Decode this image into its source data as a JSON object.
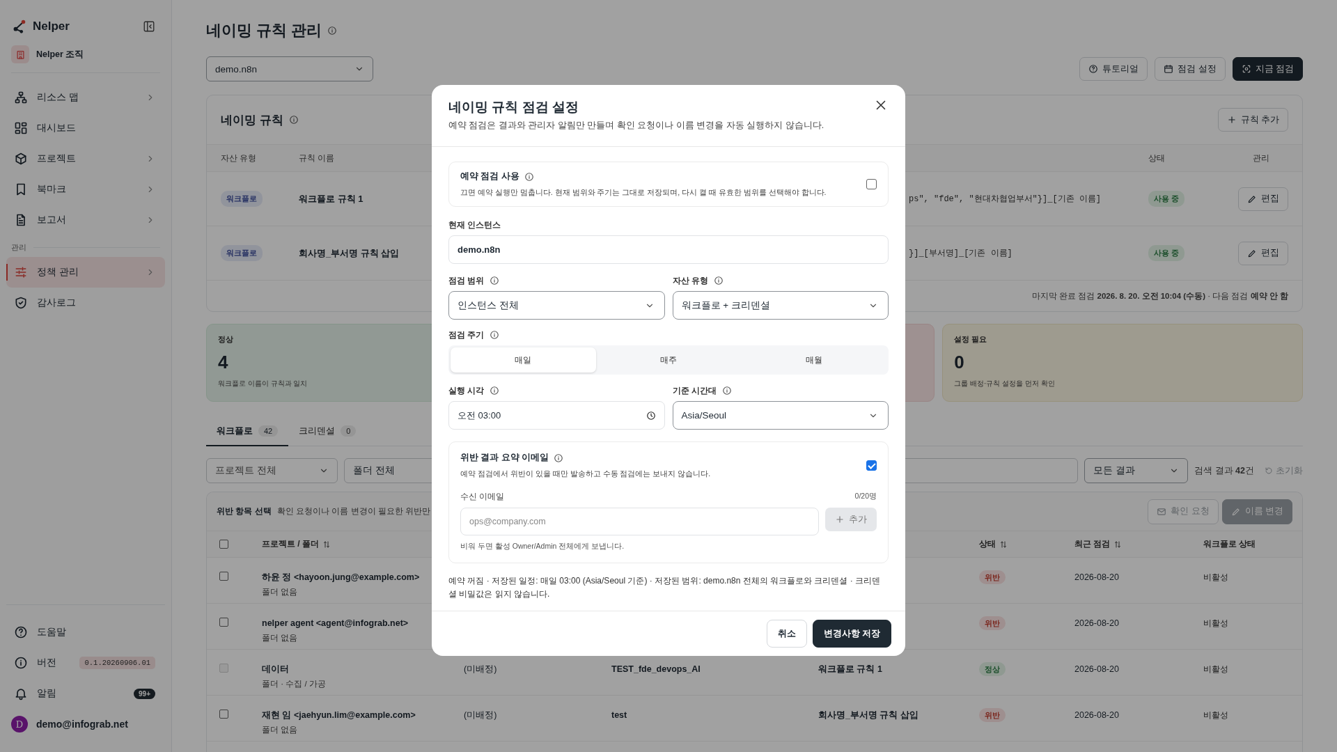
{
  "sidebar": {
    "brand": "Nelper",
    "org": "Nelper 조직",
    "groups": [
      {
        "items": [
          {
            "label": "리소스 맵",
            "expandable": true,
            "selected": false
          },
          {
            "label": "대시보드",
            "expandable": false,
            "selected": false
          },
          {
            "label": "프로젝트",
            "expandable": true,
            "selected": false
          },
          {
            "label": "북마크",
            "expandable": true,
            "selected": false
          },
          {
            "label": "보고서",
            "expandable": true,
            "selected": false
          }
        ]
      },
      {
        "label": "관리",
        "items": [
          {
            "label": "정책 관리",
            "expandable": true,
            "selected": true
          },
          {
            "label": "감사로그",
            "expandable": false,
            "selected": false
          }
        ]
      }
    ],
    "footer_items": [
      {
        "kind": "link",
        "label": "도움말"
      },
      {
        "kind": "version",
        "label": "버전",
        "badge": "0.1.20260906.01"
      },
      {
        "kind": "notice",
        "label": "알림",
        "badge": "99+"
      }
    ],
    "user": {
      "initial": "D",
      "email": "demo@infograb.net"
    }
  },
  "page": {
    "title": "네이밍 규칙 관리",
    "instance_select": "demo.n8n",
    "actions": [
      {
        "label": "튜토리얼",
        "primary": false
      },
      {
        "label": "점검 설정",
        "primary": false
      },
      {
        "label": "지금 점검",
        "primary": true
      }
    ]
  },
  "rules": {
    "title": "네이밍 규칙",
    "add_button": "규칙 추가",
    "columns": {
      "asset_type": "자산 유형",
      "rule_name": "규칙 이름",
      "status": "상태",
      "manage": "관리"
    },
    "rows": [
      {
        "asset_type": "워크플로",
        "name": "워크플로 규칙 1",
        "pattern": "ps\", \"fde\", \"현대차협업부서\"}]_[기존 이름]",
        "status": "사용 중",
        "edit": "편집"
      },
      {
        "asset_type": "워크플로",
        "name": "회사명_부서명 규칙 삽입",
        "pattern": "}]_[부서명]_[기존 이름]",
        "status": "사용 중",
        "edit": "편집"
      }
    ],
    "footer": "마지막 완료 점검 **2026. 8. 20. 오전 10:04 (수동)** · 다음 점검 **예약 안 함**"
  },
  "stats": [
    {
      "kind": "ok",
      "label": "정상",
      "value": "4",
      "caption": "워크플로 이름이 규칙과 일치"
    },
    {
      "kind": "danger"
    },
    {
      "kind": "warning",
      "label": "설정 필요",
      "value": "0",
      "caption": "그룹 배정·규칙 설정을 먼저 확인"
    }
  ],
  "tabs": [
    {
      "label": "워크플로",
      "count": "42",
      "selected": true
    },
    {
      "label": "크리덴셜",
      "count": "0",
      "selected": false
    }
  ],
  "filters": {
    "project": "프로젝트 전체",
    "folder": "폴더 전체",
    "result": "모든 결과",
    "count_text": "검색 결과 **42**건",
    "reset": "초기화"
  },
  "results": {
    "selection_title": "위반 항목 선택",
    "selection_hint": "확인 요청이나 이름 변경이 필요한 위반만",
    "actions": [
      {
        "label": "확인 요청",
        "primary": false,
        "disabled": true
      },
      {
        "label": "이름 변경",
        "primary": true,
        "disabled": true
      }
    ],
    "select_all": {
      "checked": false
    },
    "columns": [
      {
        "label": "프로젝트 / 폴더",
        "sortable": true
      },
      {
        "label": "상태",
        "sortable": true
      },
      {
        "label": "최근 점검",
        "sortable": true
      },
      {
        "label": "워크플로 상태",
        "sortable": false
      }
    ],
    "rows": [
      {
        "checked": false,
        "disabled": false,
        "project": "하윤 정 <hayoon.jung@example.com>",
        "folder": "폴더 없음",
        "status": "위반",
        "kind": "violation",
        "checked_at": "2026-08-20",
        "workflow_state": "비활성"
      },
      {
        "checked": false,
        "disabled": false,
        "project": "nelper agent <agent@infograb.net>",
        "folder": "폴더 없음",
        "status": "위반",
        "kind": "violation",
        "checked_at": "2026-08-20",
        "workflow_state": "비활성"
      },
      {
        "checked": false,
        "disabled": true,
        "project": "데이터",
        "folder": "폴더 · 수집 / 가공",
        "column_3": "(미배정)",
        "column_4": "TEST_fde_devops_AI",
        "column_5": "워크플로 규칙 1",
        "status": "정상",
        "kind": "ok",
        "checked_at": "2026-08-20",
        "workflow_state": "비활성"
      },
      {
        "checked": false,
        "disabled": false,
        "project": "재현 임 <jaehyun.lim@example.com>",
        "folder": "폴더 없음",
        "column_3": "(미배정)",
        "column_4": "test",
        "column_5": "회사명_부서명 규칙 삽입",
        "status": "위반",
        "kind": "violation",
        "checked_at": "2026-08-20",
        "workflow_state": "비활성"
      }
    ]
  },
  "dialog": {
    "title": "네이밍 규칙 점검 설정",
    "subtitle": "예약 점검은 결과와 관리자 알림만 만들며 확인 요청이나 이름 변경을 자동 실행하지 않습니다.",
    "schedule_toggle": {
      "label": "예약 점검 사용",
      "help": "끄면 예약 실행만 멈춥니다. 현재 범위와 주기는 그대로 저장되며, 다시 켤 때 유효한 범위를 선택해야 합니다.",
      "checked": false
    },
    "instance": {
      "label": "현재 인스턴스",
      "value": "demo.n8n"
    },
    "scope": {
      "label": "점검 범위",
      "value": "인스턴스 전체"
    },
    "asset_type": {
      "label": "자산 유형",
      "value": "워크플로 + 크리덴셜"
    },
    "frequency": {
      "label": "점검 주기",
      "options": [
        {
          "label": "매일",
          "selected": true
        },
        {
          "label": "매주",
          "selected": false
        },
        {
          "label": "매월",
          "selected": false
        }
      ]
    },
    "run_time": {
      "label": "실행 시각",
      "value": "오전 03:00"
    },
    "timezone": {
      "label": "기준 시간대",
      "value": "Asia/Seoul"
    },
    "email": {
      "label": "위반 결과 요약 이메일",
      "help": "예약 점검에서 위반이 있을 때만 발송하고 수동 점검에는 보내지 않습니다.",
      "checked": true,
      "recipients_label": "수신 이메일",
      "count": "0/20명",
      "placeholder": "ops@company.com",
      "add_button": "추가",
      "add_disabled": true,
      "hint": "비워 두면 활성 Owner/Admin 전체에게 보냅니다."
    },
    "summary": "예약 꺼짐 · 저장된 일정: 매일 03:00 (Asia/Seoul 기준) · 저장된 범위: demo.n8n 전체의 워크플로와 크리덴셜 · 크리덴셜 비밀값은 읽지 않습니다.",
    "buttons": [
      {
        "label": "취소",
        "primary": false
      },
      {
        "label": "변경사항 저장",
        "primary": true
      }
    ]
  }
}
